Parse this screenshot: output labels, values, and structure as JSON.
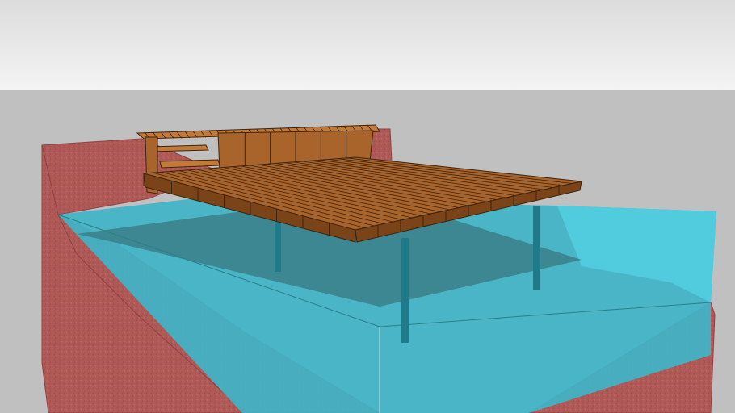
{
  "scene": {
    "subject": "wooden-deck-over-water-model",
    "colors": {
      "sky_top": "#dcdcdc",
      "sky_bottom": "#f4f4f4",
      "ground": "#c0c0c0",
      "terrain": "#b05a58",
      "terrain_dark": "#8e4442",
      "water": "#3fb4c8",
      "water_light": "#52cde0",
      "water_dark": "#3a7f87",
      "wood": "#a8642a",
      "wood_dark": "#7a4418",
      "wood_light": "#c37a38",
      "wood_line": "#3d2410",
      "post": "#1f7a8a"
    }
  }
}
